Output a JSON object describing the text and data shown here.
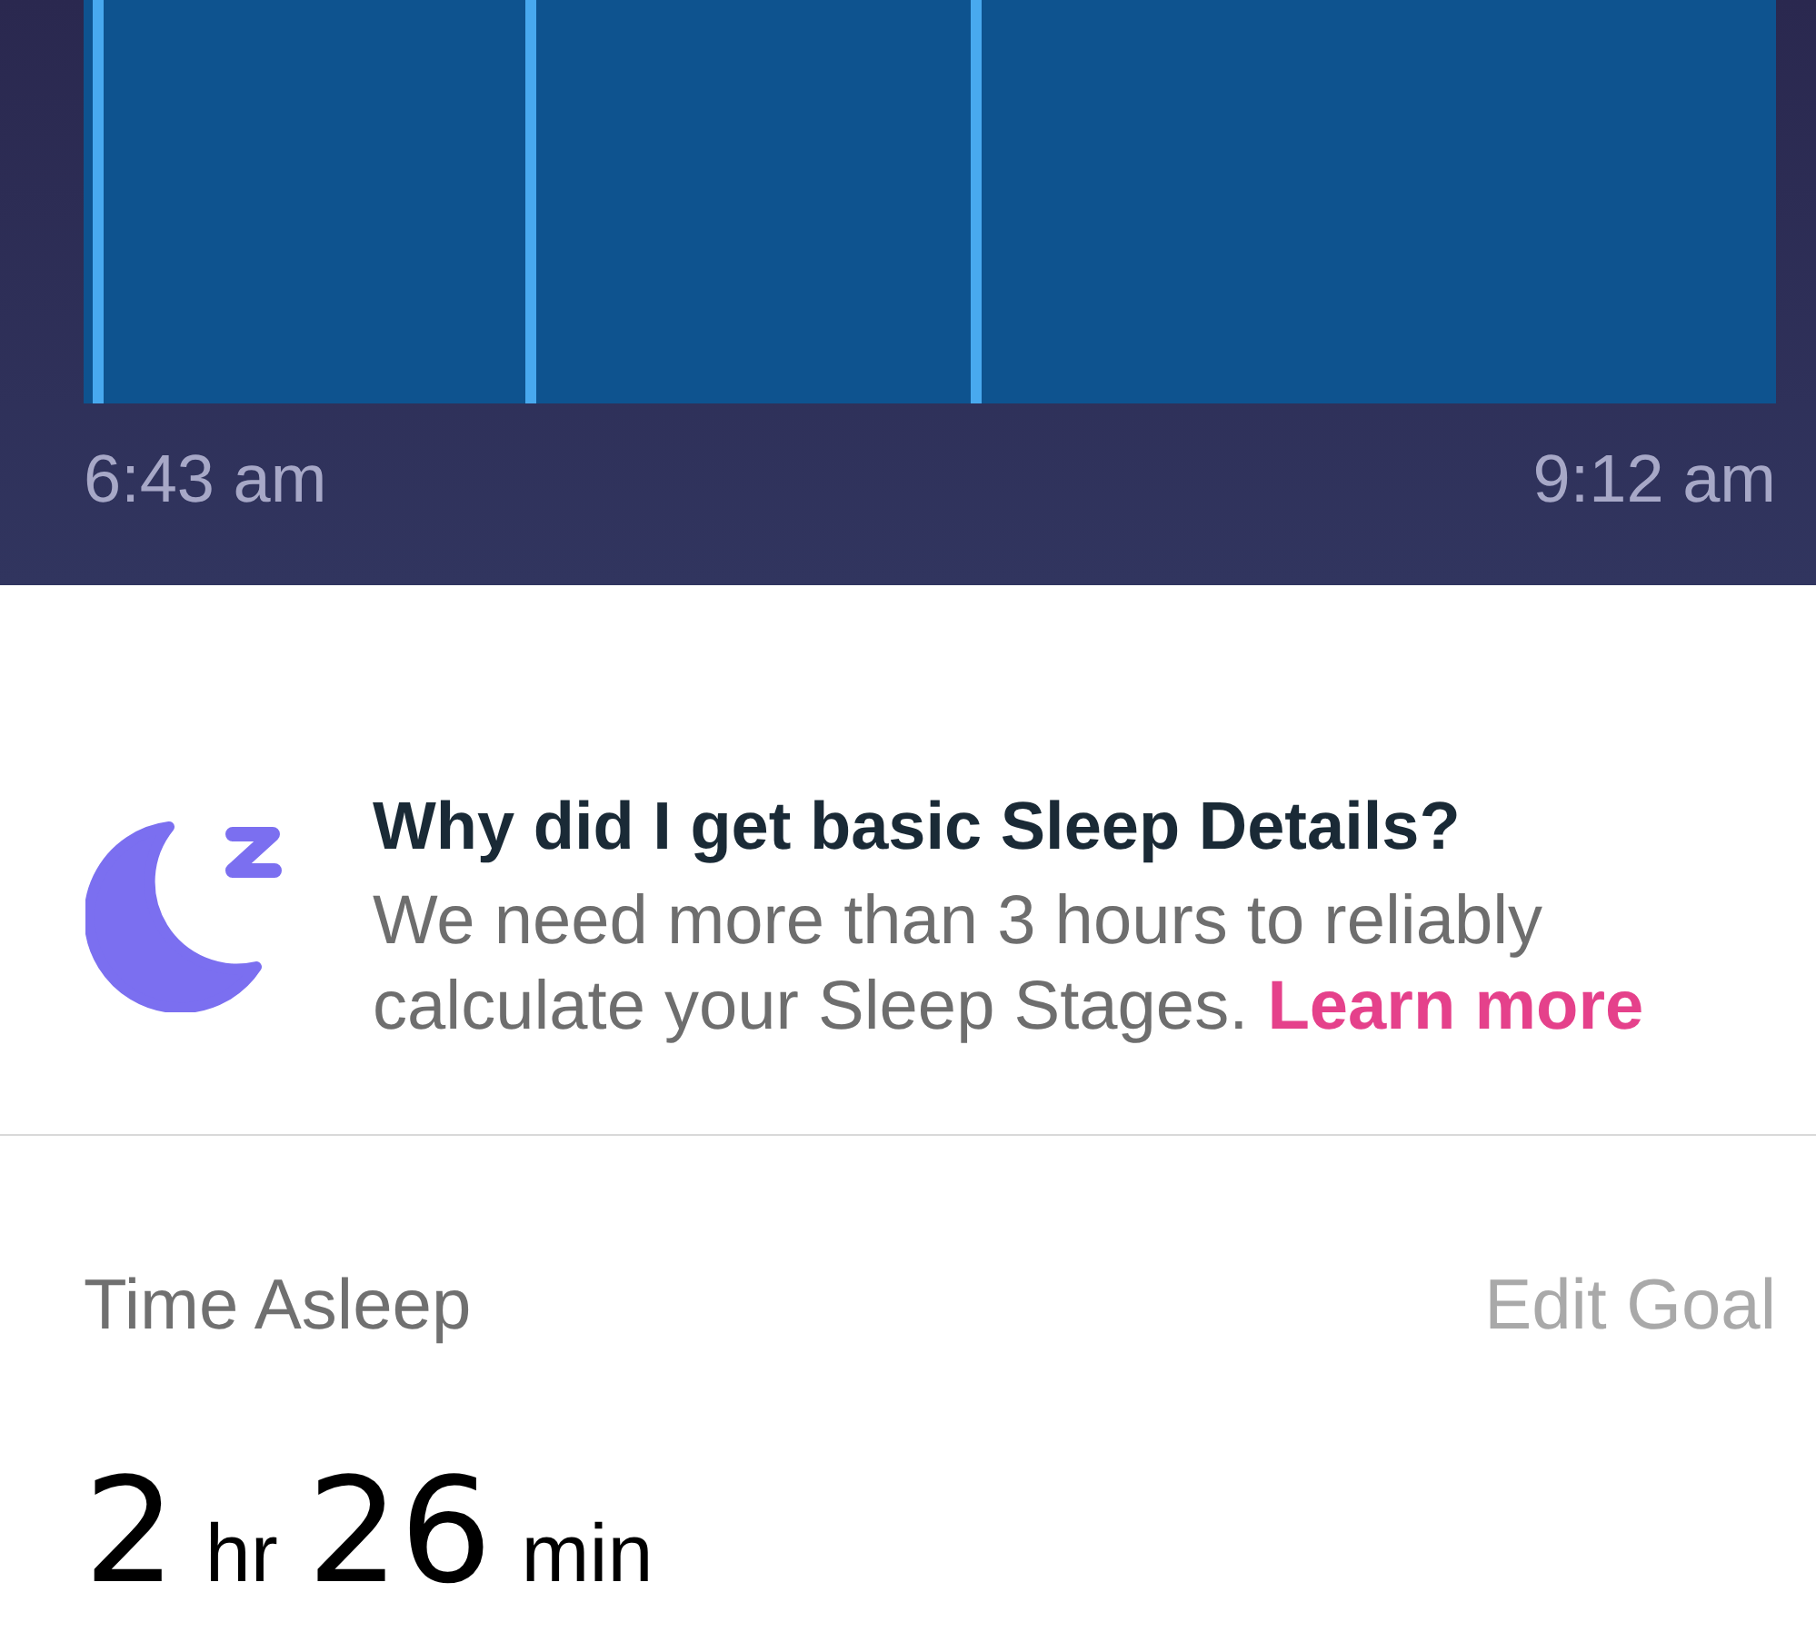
{
  "sleep_chart": {
    "start_time": "6:43 am",
    "end_time": "9:12 am"
  },
  "info": {
    "title": "Why did I get basic Sleep Details?",
    "body": "We need more than 3 hours to reliably calculate your Sleep Stages.",
    "link": "Learn more"
  },
  "time_asleep": {
    "label": "Time Asleep",
    "action": "Edit Goal",
    "hours": "2",
    "hours_unit": "hr",
    "minutes": "26",
    "minutes_unit": "min"
  }
}
